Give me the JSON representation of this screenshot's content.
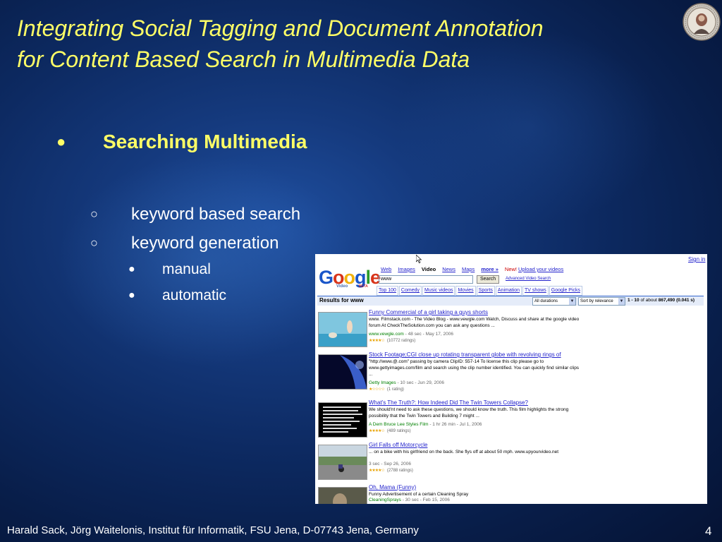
{
  "slide": {
    "title_line1": "Integrating Social Tagging and Document Annotation",
    "title_line2": "for Content Based Search in Multimedia Data",
    "heading": "Searching Multimedia",
    "sub_bullets": [
      "keyword based search",
      "keyword generation"
    ],
    "sub_sub_bullets": [
      "manual",
      "automatic"
    ],
    "footer": "Harald Sack, Jörg Waitelonis, Institut für Informatik, FSU Jena, D-07743 Jena, Germany",
    "page_number": "4",
    "colors": {
      "title": "#ffff66",
      "text": "#ffffff",
      "background": "#0d2a62"
    },
    "bullet_marks": {
      "level1": "●",
      "level2": "○",
      "level3": "●"
    }
  },
  "google_video": {
    "sign_in": "Sign in",
    "logo": "Google",
    "logo_sub": "Video",
    "logo_beta": "BETA",
    "nav": {
      "web": "Web",
      "images": "Images",
      "video": "Video",
      "news": "News",
      "maps": "Maps",
      "more": "more »",
      "new_badge": "New!",
      "upload": "Upload your videos"
    },
    "search": {
      "value": "www",
      "button": "Search",
      "advanced": "Advanced Video Search"
    },
    "categories": [
      "Top 100",
      "Comedy",
      "Music videos",
      "Movies",
      "Sports",
      "Animation",
      "TV shows",
      "Google Picks"
    ],
    "results_label": "Results for www",
    "filters": {
      "duration": "All durations",
      "sort": "Sort by relevance"
    },
    "stats": {
      "range": "1 - 10",
      "of_text": "of about",
      "total": "867,490",
      "time": "(0.041 s)"
    },
    "results": [
      {
        "title": "Funny Commercial of a girl taking a guys shorts",
        "snippet": "www. Filmstack.com - The Video Blog - www.vewgle.com Watch, Discuss and share at the google video forum At CheckTheSolution.com you can ask any questions ...",
        "source": "www.vewgle.com",
        "duration": " - 48 sec - May 17, 2006",
        "stars": "★★★★☆",
        "ratings": "(10772 ratings)"
      },
      {
        "title": "Stock Footage;CGI close up rotating transparent globe with revolving rings of",
        "snippet": "\"http://www.@.com\" passing by camera ClipID: 557-14 To license this clip please go to www.gettyimages.com/film and search using the clip number identified. You can quickly find similar clips ...",
        "source": "Getty Images",
        "duration": " - 10 sec - Jun 29, 2006",
        "stars": "★☆☆☆☆",
        "ratings": "(1 rating)"
      },
      {
        "title": "What's The Truth?: How Indeed Did The Twin Towers Collapse?",
        "snippet": "We should'nt need to ask these questions, we should know the truth. This film highlights the strong possibility that the Twin Towers and Building 7 might ...",
        "source": "A Dem Bruce Lee Styles Film",
        "duration": " - 1 hr 26 min - Jul 1, 2006",
        "stars": "★★★★☆",
        "ratings": "(489 ratings)"
      },
      {
        "title": "Girl Falls off Motorcycle",
        "snippet": "... on a bike with his girlfriend on the back. She flys off at about 50 mph. www.upyourvideo.net",
        "source": "",
        "duration": "3 sec - Sep 26, 2006",
        "stars": "★★★★☆",
        "ratings": "(2788 ratings)"
      },
      {
        "title": "Oh, Mama (Funny)",
        "snippet": "Funny Advertisement of a certain Cleaning Spray",
        "source": "CleaningSprays",
        "duration": " - 30 sec - Feb 15, 2006",
        "stars": "",
        "ratings": ""
      }
    ]
  }
}
